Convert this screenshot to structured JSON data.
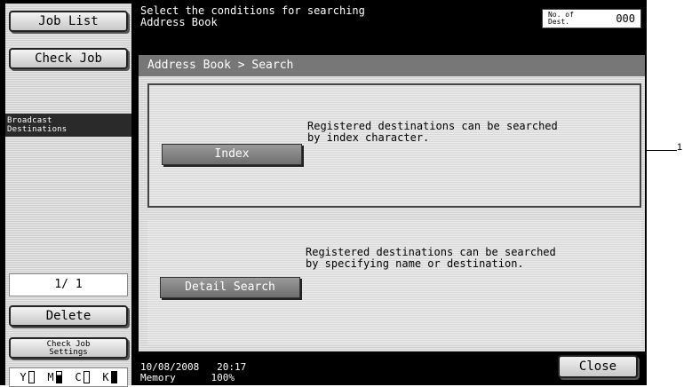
{
  "sidebar": {
    "job_list": "Job List",
    "check_job": "Check Job",
    "broadcast": "Broadcast\nDestinations",
    "page": "1/ 1",
    "delete": "Delete",
    "check_job_settings": "Check Job\nSettings",
    "toner": [
      {
        "label": "Y",
        "level": "low"
      },
      {
        "label": "M",
        "level": "partial"
      },
      {
        "label": "C",
        "level": "low"
      },
      {
        "label": "K",
        "level": "full"
      }
    ]
  },
  "header": {
    "instruction": "Select the conditions for searching\nAddress Book",
    "dest_label": "No. of\nDest.",
    "dest_count": "000"
  },
  "panel": {
    "breadcrumb": "Address Book > Search",
    "options": [
      {
        "button": "Index",
        "description": "Registered destinations can be searched\nby index character."
      },
      {
        "button": "Detail Search",
        "description": "Registered destinations can be searched\nby specifying name or destination."
      }
    ]
  },
  "status": {
    "date": "10/08/2008",
    "time": "20:17",
    "memory_label": "Memory",
    "memory_value": "100%"
  },
  "footer": {
    "close": "Close"
  },
  "callout": "1"
}
